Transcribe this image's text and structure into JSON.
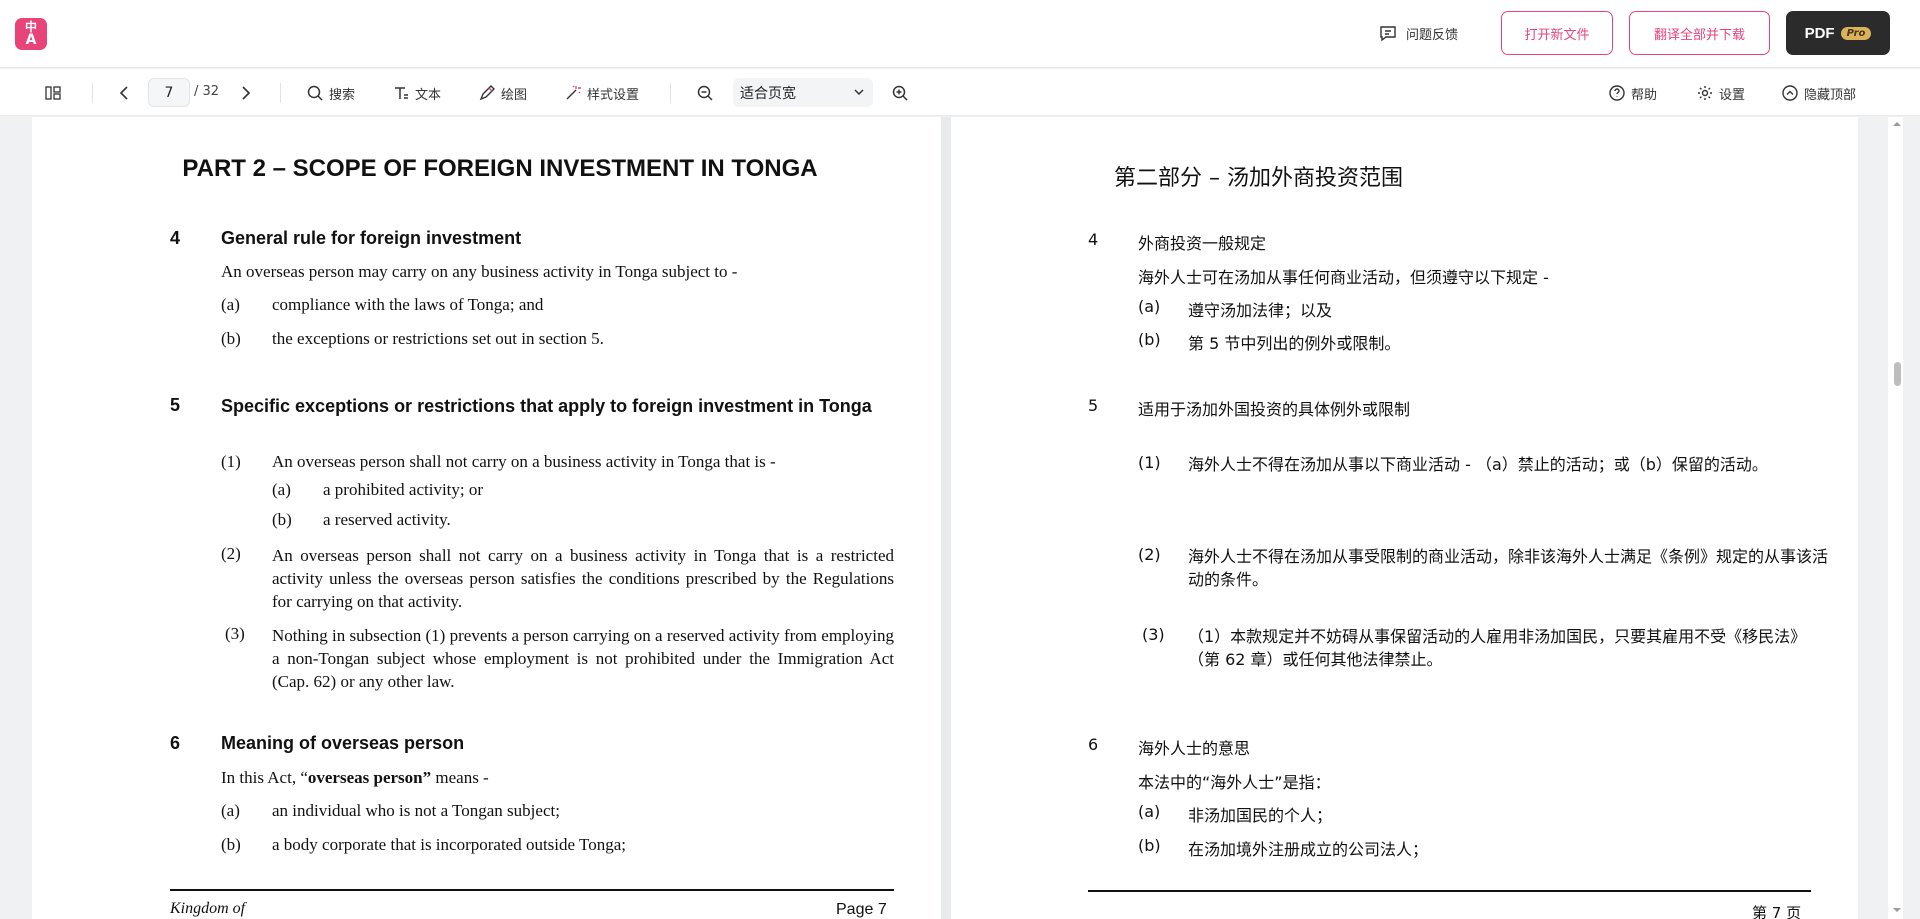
{
  "header": {
    "logo": {
      "line1": "中",
      "line2": "A",
      "icon": "app-logo-icon"
    },
    "feedback_label": "问题反馈",
    "open_file_label": "打开新文件",
    "translate_download_label": "翻译全部并下载",
    "pro_button": {
      "pdf": "PDF",
      "badge": "Pro"
    }
  },
  "toolbar": {
    "current_page": "7",
    "total_pages": "/ 32",
    "search_label": "搜索",
    "text_label": "文本",
    "draw_label": "绘图",
    "style_label": "样式设置",
    "zoom_value": "适合页宽",
    "help_label": "帮助",
    "settings_label": "设置",
    "hide_top_label": "隐藏顶部"
  },
  "left_page": {
    "part_title": "PART 2 – SCOPE OF FOREIGN INVESTMENT IN TONGA",
    "s4": {
      "num": "4",
      "title": "General rule for foreign investment",
      "intro": "An overseas person may carry on any business activity in Tonga subject to -",
      "a_label": "(a)",
      "a_text": "compliance with the laws of Tonga; and",
      "b_label": "(b)",
      "b_text": "the exceptions or restrictions set out in section 5."
    },
    "s5": {
      "num": "5",
      "title": "Specific exceptions or restrictions that apply to foreign investment in Tonga",
      "p1_label": "(1)",
      "p1_text": "An overseas person shall not carry on a business activity in Tonga that is -",
      "p1a_label": "(a)",
      "p1a_text": "a prohibited activity; or",
      "p1b_label": "(b)",
      "p1b_text": "a reserved activity.",
      "p2_label": "(2)",
      "p2_text": "An overseas person shall not carry on a business activity in Tonga that is a restricted activity unless the overseas person satisfies the conditions prescribed by the Regulations for carrying on that activity.",
      "p3_label": "(3)",
      "p3_text": "Nothing in subsection (1) prevents a person carrying on a reserved activity from employing a non-Tongan subject whose employment is not prohibited under the Immigration Act (Cap. 62) or any other law."
    },
    "s6": {
      "num": "6",
      "title": "Meaning of overseas person",
      "intro_pre": "In this Act, “",
      "intro_bold": "overseas person”",
      "intro_post": " means -",
      "a_label": "(a)",
      "a_text": "an individual who is not a Tongan subject;",
      "b_label": "(b)",
      "b_text": "a body corporate that is incorporated outside Tonga;"
    },
    "footer_left": "Kingdom of",
    "footer_page": "Page 7"
  },
  "right_page": {
    "part_title": "第二部分 – 汤加外商投资范围",
    "s4": {
      "num": "4",
      "title": "外商投资一般规定",
      "intro": "海外人士可在汤加从事任何商业活动，但须遵守以下规定 -",
      "a_label": "(a)",
      "a_text": "遵守汤加法律；以及",
      "b_label": "(b)",
      "b_text": "第 5 节中列出的例外或限制。"
    },
    "s5": {
      "num": "5",
      "title": "适用于汤加外国投资的具体例外或限制",
      "p1_label": "(1)",
      "p1_text": "海外人士不得在汤加从事以下商业活动 - （a）禁止的活动；或（b）保留的活动。",
      "p2_label": "(2)",
      "p2_text": "海外人士不得在汤加从事受限制的商业活动，除非该海外人士满足《条例》规定的从事该活动的条件。",
      "p3_label": "(3)",
      "p3_text": "（1）本款规定并不妨碍从事保留活动的人雇用非汤加国民，只要其雇用不受《移民法》（第 62 章）或任何其他法律禁止。"
    },
    "s6": {
      "num": "6",
      "title": "海外人士的意思",
      "intro": "本法中的“海外人士”是指：",
      "a_label": "(a)",
      "a_text": "非汤加国民的个人；",
      "b_label": "(b)",
      "b_text": "在汤加境外注册成立的公司法人；"
    },
    "footer_page": "第 7 页"
  }
}
